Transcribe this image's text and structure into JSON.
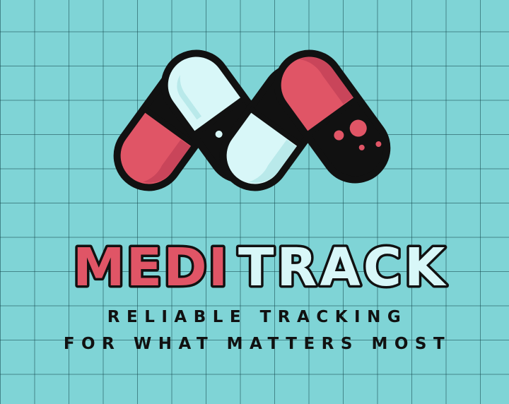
{
  "brand": {
    "name_part_1": "MEDI",
    "name_part_2": "TRACK",
    "tagline_line_1": "RELIABLE TRACKING",
    "tagline_line_2": "FOR WHAT MATTERS MOST"
  },
  "colors": {
    "background": "#7fd4d6",
    "grid_line": "#14464b",
    "pill_red": "#e05566",
    "pill_red_shade": "#c9455a",
    "pill_white": "#d8f7f8",
    "pill_black": "#111111",
    "word_red": "#e05566",
    "word_white": "#d8f7f8",
    "outline": "#111111"
  },
  "icons": {
    "logo": "pill-capsules-m-icon"
  }
}
